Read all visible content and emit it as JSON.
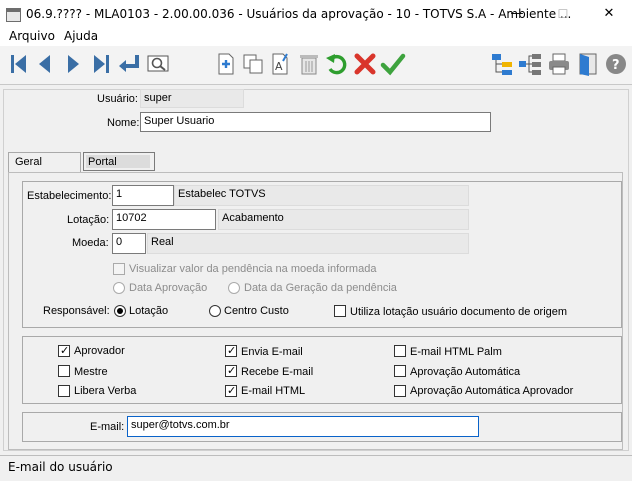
{
  "window": {
    "title": "06.9.???? - MLA0103 - 2.00.00.036 - Usuários da aprovação - 10 - TOTVS S.A - Ambiente ...",
    "controls": {
      "minimize": "—",
      "maximize": "☐",
      "close": "✕"
    }
  },
  "menu": {
    "items": [
      "Arquivo",
      "Ajuda"
    ]
  },
  "toolbar": {
    "buttons": [
      "first-record",
      "previous-record",
      "next-record",
      "last-record",
      "go-to",
      "search",
      "new",
      "copy",
      "edit",
      "delete",
      "undo",
      "cancel",
      "confirm",
      "tree-view",
      "hierarchy",
      "print",
      "exit"
    ]
  },
  "header": {
    "usuario_label": "Usuário:",
    "usuario_value": "super",
    "nome_label": "Nome:",
    "nome_value": "Super Usuario"
  },
  "tabs": [
    {
      "label": "Geral",
      "active": true
    },
    {
      "label": "Portal",
      "active": false
    }
  ],
  "geral": {
    "estabelecimento_label": "Estabelecimento:",
    "estabelecimento_value": "1",
    "estabelecimento_desc": "Estabelec TOTVS",
    "lotacao_label": "Lotação:",
    "lotacao_value": "10702",
    "lotacao_desc": "Acabamento",
    "moeda_label": "Moeda:",
    "moeda_value": "0",
    "moeda_desc": "Real",
    "visualizar_label": "Visualizar valor da pendência na moeda informada",
    "data_aprovacao_label": "Data Aprovação",
    "data_geracao_label": "Data da Geração da pendência",
    "responsavel_label": "Responsável:",
    "responsavel_options": [
      "Lotação",
      "Centro Custo"
    ],
    "responsavel_selected": "Lotação",
    "utiliza_label": "Utiliza lotação usuário documento de origem"
  },
  "flags": {
    "aprovador": {
      "label": "Aprovador",
      "checked": true
    },
    "mestre": {
      "label": "Mestre",
      "checked": false
    },
    "libera_verba": {
      "label": "Libera Verba",
      "checked": false
    },
    "envia_email": {
      "label": "Envia E-mail",
      "checked": true
    },
    "recebe_email": {
      "label": "Recebe E-mail",
      "checked": true
    },
    "email_html": {
      "label": "E-mail HTML",
      "checked": true
    },
    "email_html_palm": {
      "label": "E-mail HTML Palm",
      "checked": false
    },
    "aprovacao_automatica": {
      "label": "Aprovação Automática",
      "checked": false
    },
    "aprovacao_automatica_aprovador": {
      "label": "Aprovação Automática Aprovador",
      "checked": false
    }
  },
  "email": {
    "label": "E-mail:",
    "value": "super@totvs.com.br"
  },
  "status": {
    "text": "E-mail do usuário"
  },
  "colors": {
    "accent_green": "#2e9e2e",
    "cancel_red": "#d9352b",
    "nav_blue": "#3a6ea5",
    "border": "#7a7a7a"
  }
}
